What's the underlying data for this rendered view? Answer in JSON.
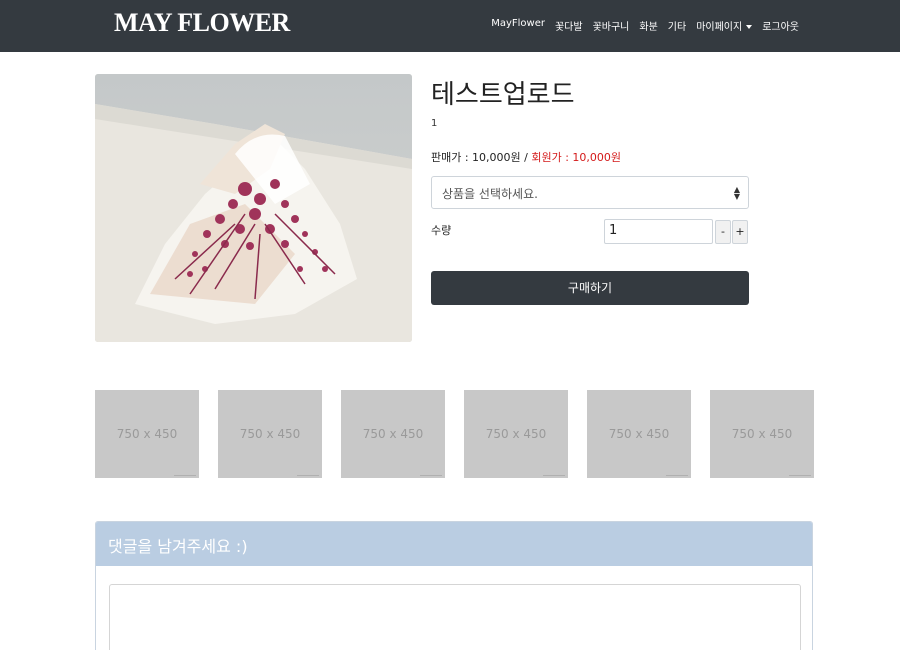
{
  "navbar": {
    "brand": "MAY FLOWER",
    "links": [
      "MayFlower",
      "꽃다발",
      "꽃바구니",
      "화분",
      "기타",
      "마이페이지",
      "로그아웃"
    ],
    "bg_color": "#343a40"
  },
  "product": {
    "title": "테스트업로드",
    "subtitle": "1",
    "price_label": "판매가 : 10,000원 / ",
    "member_price_label": "회원가 : 10,000원",
    "member_price_color": "#d41a1a",
    "option_placeholder": "상품을 선택하세요.",
    "quantity_label": "수량",
    "quantity_value": "1",
    "minus_label": "-",
    "plus_label": "+",
    "buy_label": "구매하기"
  },
  "thumbnails": [
    "750 x 450",
    "750 x 450",
    "750 x 450",
    "750 x 450",
    "750 x 450",
    "750 x 450"
  ],
  "comments": {
    "header": "댓글을 남겨주세요 :)",
    "header_color": "#bacde2"
  }
}
